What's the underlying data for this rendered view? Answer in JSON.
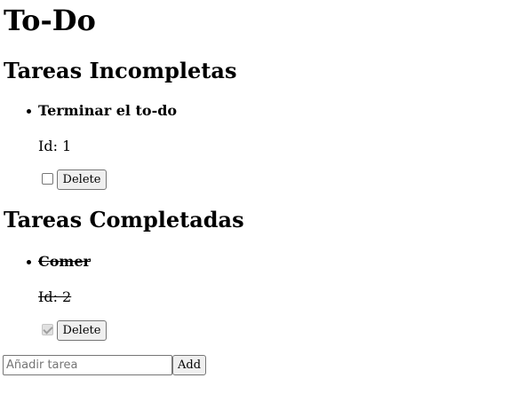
{
  "page": {
    "title": "To-Do"
  },
  "incomplete": {
    "heading": "Tareas Incompletas",
    "tasks": [
      {
        "title": "Terminar el to-do",
        "id_label": "Id: 1",
        "checked": false,
        "delete_label": "Delete"
      }
    ]
  },
  "complete": {
    "heading": "Tareas Completadas",
    "tasks": [
      {
        "title": "Comer",
        "id_label": "Id: 2",
        "checked": true,
        "delete_label": "Delete"
      }
    ]
  },
  "new_task": {
    "placeholder": "Añadir tarea",
    "value": "",
    "add_label": "Add"
  }
}
